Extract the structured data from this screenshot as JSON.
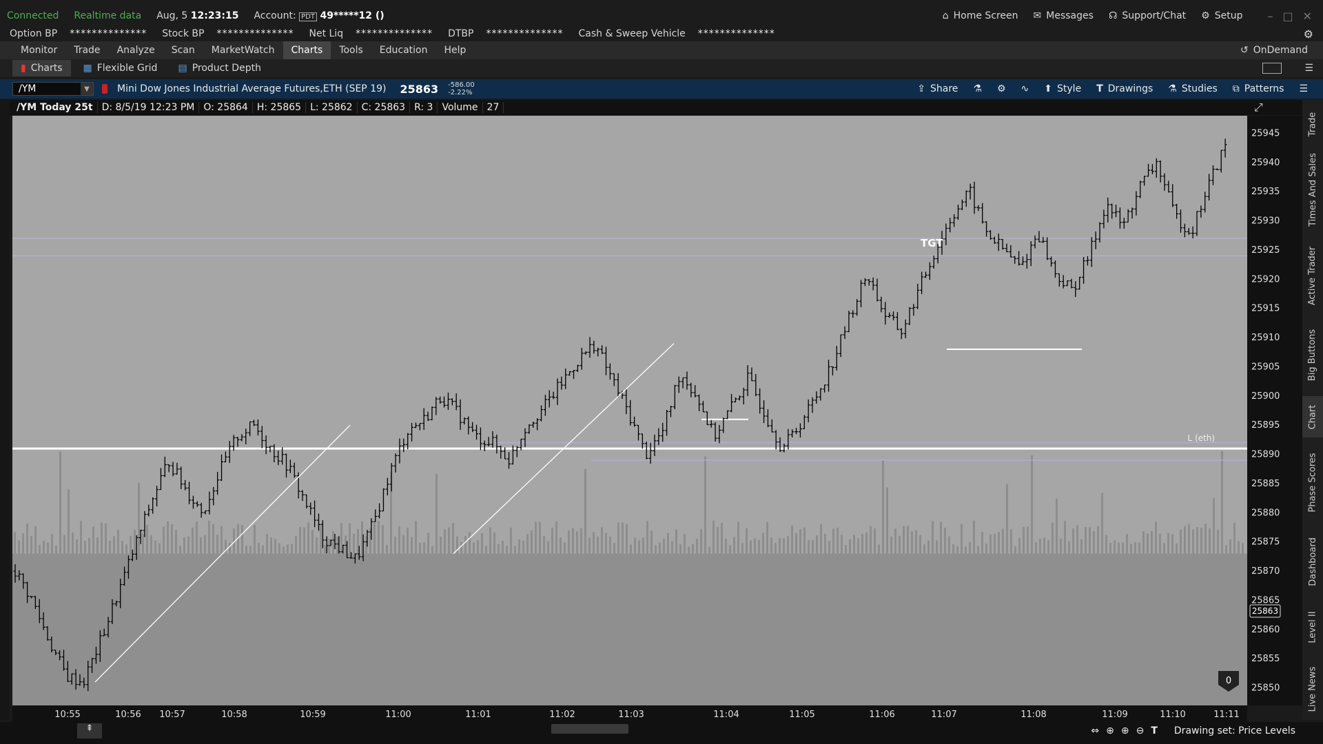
{
  "status": {
    "connected": "Connected",
    "realtime": "Realtime data",
    "date": "Aug, 5",
    "time": "12:23:15",
    "account_label": "Account:",
    "account_badge": "PDT",
    "account_number": "49*****12 ()",
    "home_screen": "Home Screen",
    "messages": "Messages",
    "support": "Support/Chat",
    "setup": "Setup"
  },
  "bp": {
    "option_bp_label": "Option BP",
    "option_bp_value": "**************",
    "stock_bp_label": "Stock BP",
    "stock_bp_value": "**************",
    "net_liq_label": "Net Liq",
    "net_liq_value": "**************",
    "dtbp_label": "DTBP",
    "dtbp_value": "**************",
    "cash_label": "Cash & Sweep Vehicle",
    "cash_value": "**************"
  },
  "menu": [
    "Monitor",
    "Trade",
    "Analyze",
    "Scan",
    "MarketWatch",
    "Charts",
    "Tools",
    "Education",
    "Help"
  ],
  "menu_active": "Charts",
  "ondemand": "OnDemand",
  "subtabs": {
    "charts": "Charts",
    "flexible_grid": "Flexible Grid",
    "product_depth": "Product Depth"
  },
  "chart_header": {
    "symbol": "/YM",
    "description": "Mini Dow Jones Industrial Average Futures,ETH (SEP 19)",
    "last": "25863",
    "change": "-586.00",
    "change_pct": "-2.22%",
    "share": "Share",
    "style": "Style",
    "drawings": "Drawings",
    "studies": "Studies",
    "patterns": "Patterns"
  },
  "info": {
    "title": "/YM Today 25t",
    "date": "D: 8/5/19 12:23 PM",
    "open": "O: 25864",
    "high": "H: 25865",
    "low": "L: 25862",
    "close": "C: 25863",
    "range": "R: 3",
    "volume_label": "Volume",
    "volume": "27"
  },
  "side_tabs": [
    "Trade",
    "Times And Sales",
    "Active Trader",
    "Big Buttons",
    "Chart",
    "Phase Scores",
    "Dashboard",
    "Level II",
    "Live News"
  ],
  "bottom": {
    "drawing_set": "Drawing set: Price Levels",
    "zero_badge": "0"
  },
  "colors": {
    "chart_bg": "#a6a6a6",
    "chart_lower_bg": "#8f8f8f",
    "header_bg": "#0f2d4a",
    "connected": "#4caf50",
    "line": "#ffffff",
    "level_line": "#b9b4d8"
  },
  "chart_data": {
    "type": "candlestick",
    "symbol": "/YM",
    "y_ticks": [
      25945,
      25940,
      25935,
      25930,
      25925,
      25920,
      25915,
      25910,
      25905,
      25900,
      25895,
      25890,
      25885,
      25880,
      25875,
      25870,
      25865,
      25860,
      25855,
      25850
    ],
    "ylim": [
      25847,
      25948
    ],
    "x_ticks": [
      "10:55",
      "10:56",
      "10:57",
      "10:58",
      "10:59",
      "11:00",
      "11:01",
      "11:02",
      "11:03",
      "11:04",
      "11:05",
      "11:06",
      "11:07",
      "11:08",
      "11:09",
      "11:10",
      "11:11"
    ],
    "current_price_label": "25863",
    "annotations": {
      "target": "TGT",
      "low_eth": "L (eth)"
    },
    "horizontal_levels": [
      25927,
      25924,
      25891,
      25892,
      25889
    ],
    "price_path": [
      25870,
      25865,
      25858,
      25852,
      25851,
      25858,
      25866,
      25874,
      25882,
      25889,
      25884,
      25880,
      25887,
      25893,
      25895,
      25891,
      25888,
      25882,
      25876,
      25874,
      25872,
      25878,
      25887,
      25894,
      25896,
      25900,
      25897,
      25893,
      25892,
      25889,
      25895,
      25898,
      25902,
      25906,
      25909,
      25903,
      25897,
      25890,
      25894,
      25904,
      25900,
      25893,
      25898,
      25903,
      25897,
      25891,
      25895,
      25900,
      25906,
      25914,
      25921,
      25914,
      25911,
      25918,
      25925,
      25931,
      25935,
      25928,
      25925,
      25922,
      25928,
      25921,
      25918,
      25924,
      25933,
      25929,
      25936,
      25940,
      25931,
      25928,
      25936,
      25943
    ]
  }
}
